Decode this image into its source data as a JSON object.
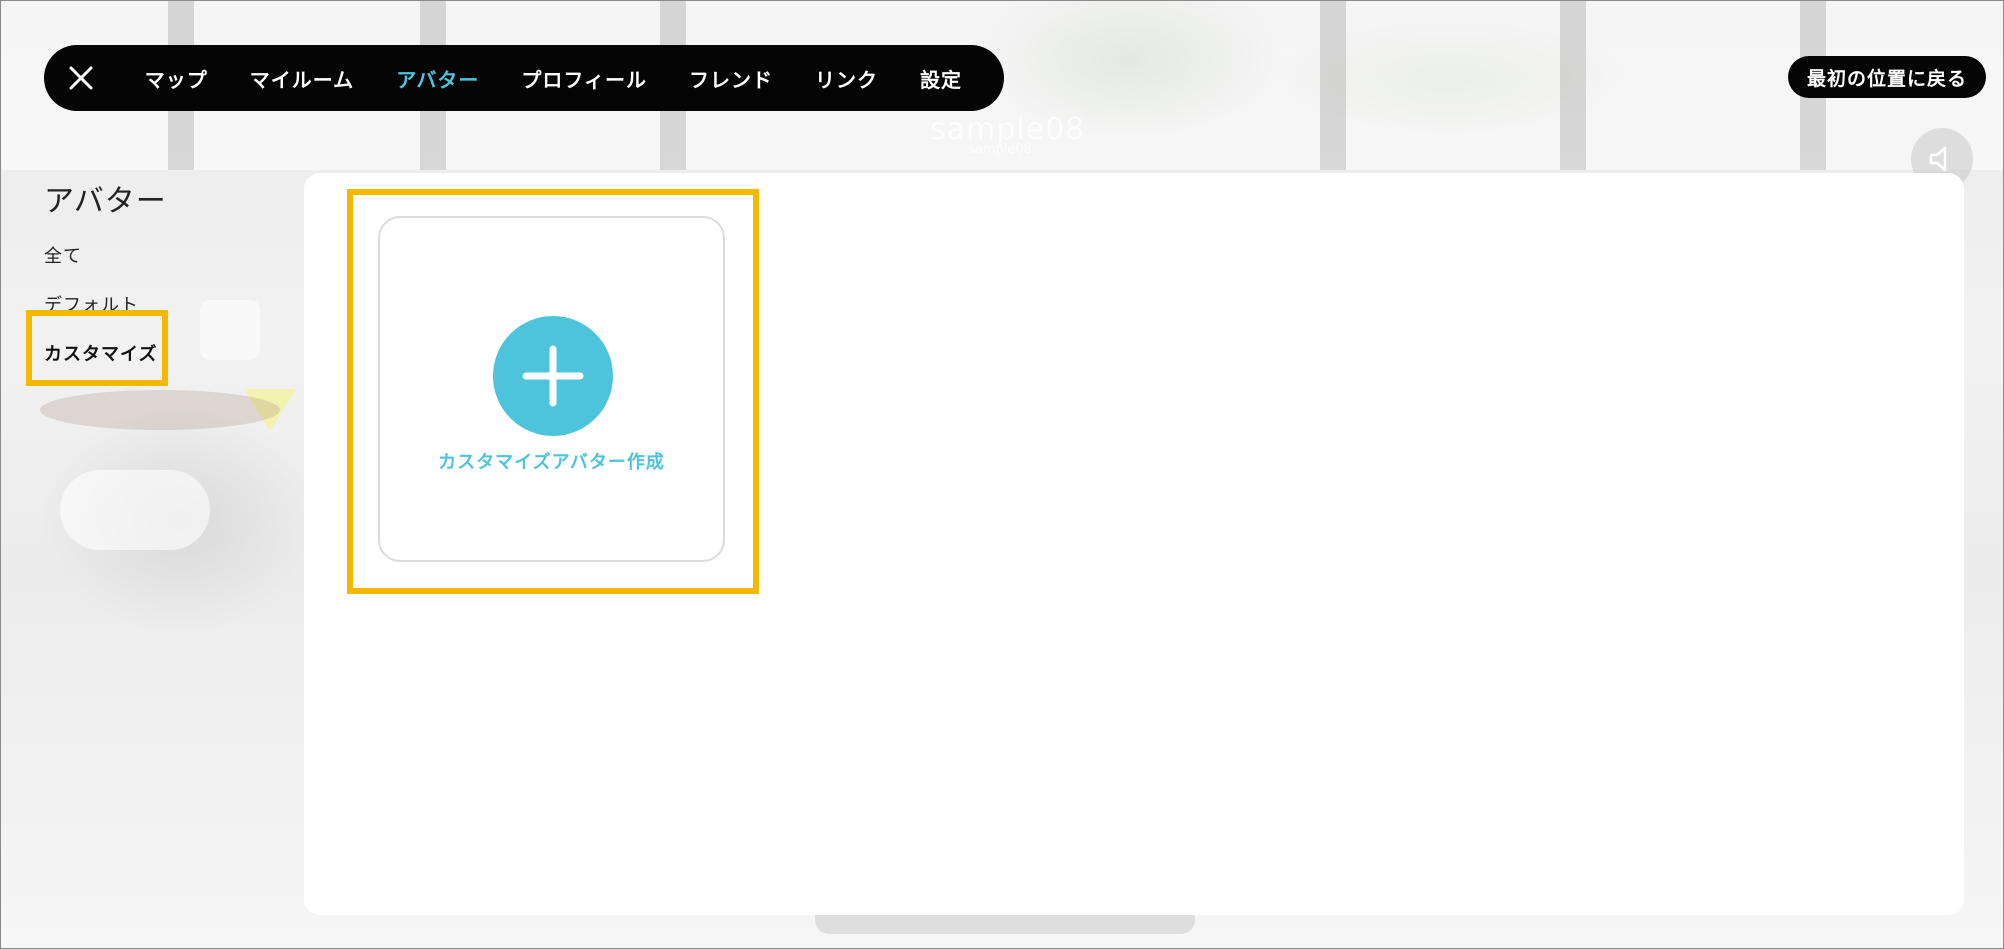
{
  "colors": {
    "accent": "#4ec3dc",
    "highlight": "#f5b800",
    "nav_bg": "#050505",
    "panel_bg": "#ffffff"
  },
  "background": {
    "world_name": "sample08",
    "world_sub": "sample08"
  },
  "topnav": {
    "close_icon": "close-icon",
    "items": [
      {
        "label": "マップ",
        "active": false
      },
      {
        "label": "マイルーム",
        "active": false
      },
      {
        "label": "アバター",
        "active": true
      },
      {
        "label": "プロフィール",
        "active": false
      },
      {
        "label": "フレンド",
        "active": false
      },
      {
        "label": "リンク",
        "active": false
      },
      {
        "label": "設定",
        "active": false
      }
    ]
  },
  "return_button": {
    "label": "最初の位置に戻る"
  },
  "sound_button": {
    "icon": "speaker-icon"
  },
  "sidebar": {
    "title": "アバター",
    "items": [
      {
        "label": "全て",
        "selected": false
      },
      {
        "label": "デフォルト",
        "selected": false
      },
      {
        "label": "カスタマイズ",
        "selected": true
      }
    ]
  },
  "main": {
    "create_card": {
      "icon": "plus-icon",
      "label": "カスタマイズアバター作成"
    }
  }
}
